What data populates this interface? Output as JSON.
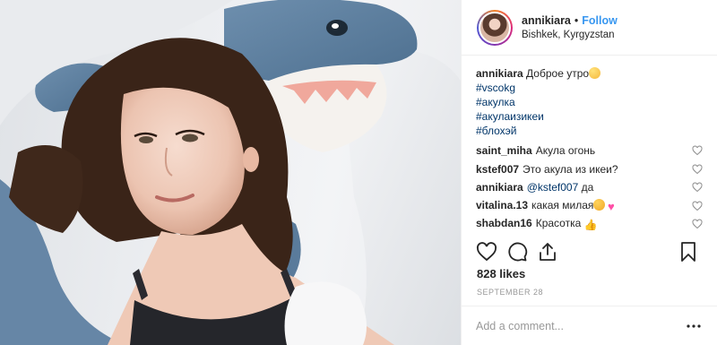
{
  "header": {
    "username": "annikiara",
    "separator": "•",
    "follow_label": "Follow",
    "location": "Bishkek, Kyrgyzstan"
  },
  "caption": {
    "username": "annikiara",
    "text": "Доброе утро",
    "emoji": "smile-emoji",
    "hashtags": [
      "#vscokg",
      "#акулка",
      "#акулаизикеи",
      "#блохэй"
    ]
  },
  "comments": [
    {
      "user": "saint_miha",
      "text": "Акула огонь"
    },
    {
      "user": "kstef007",
      "text": "Это акула из икеи?"
    },
    {
      "user": "annikiara",
      "mention": "@kstef007",
      "text": "да"
    },
    {
      "user": "vitalina.13",
      "text": "какая милая",
      "emojis": [
        "heart-eyes-emoji",
        "heart-emoji"
      ]
    },
    {
      "user": "shabdan16",
      "text": "Красотка",
      "emojis": [
        "thumbs-up-emoji"
      ]
    }
  ],
  "actions": {
    "icons": [
      "heart-icon",
      "comment-icon",
      "share-icon",
      "bookmark-icon"
    ]
  },
  "likes_label": "828 likes",
  "date": "SEPTEMBER 28",
  "add_comment": {
    "placeholder": "Add a comment...",
    "more_icon": "more-options-icon"
  },
  "colors": {
    "link": "#3897f0",
    "hashtag": "#003569",
    "muted": "#999999",
    "shark": "#5b7e9e"
  }
}
